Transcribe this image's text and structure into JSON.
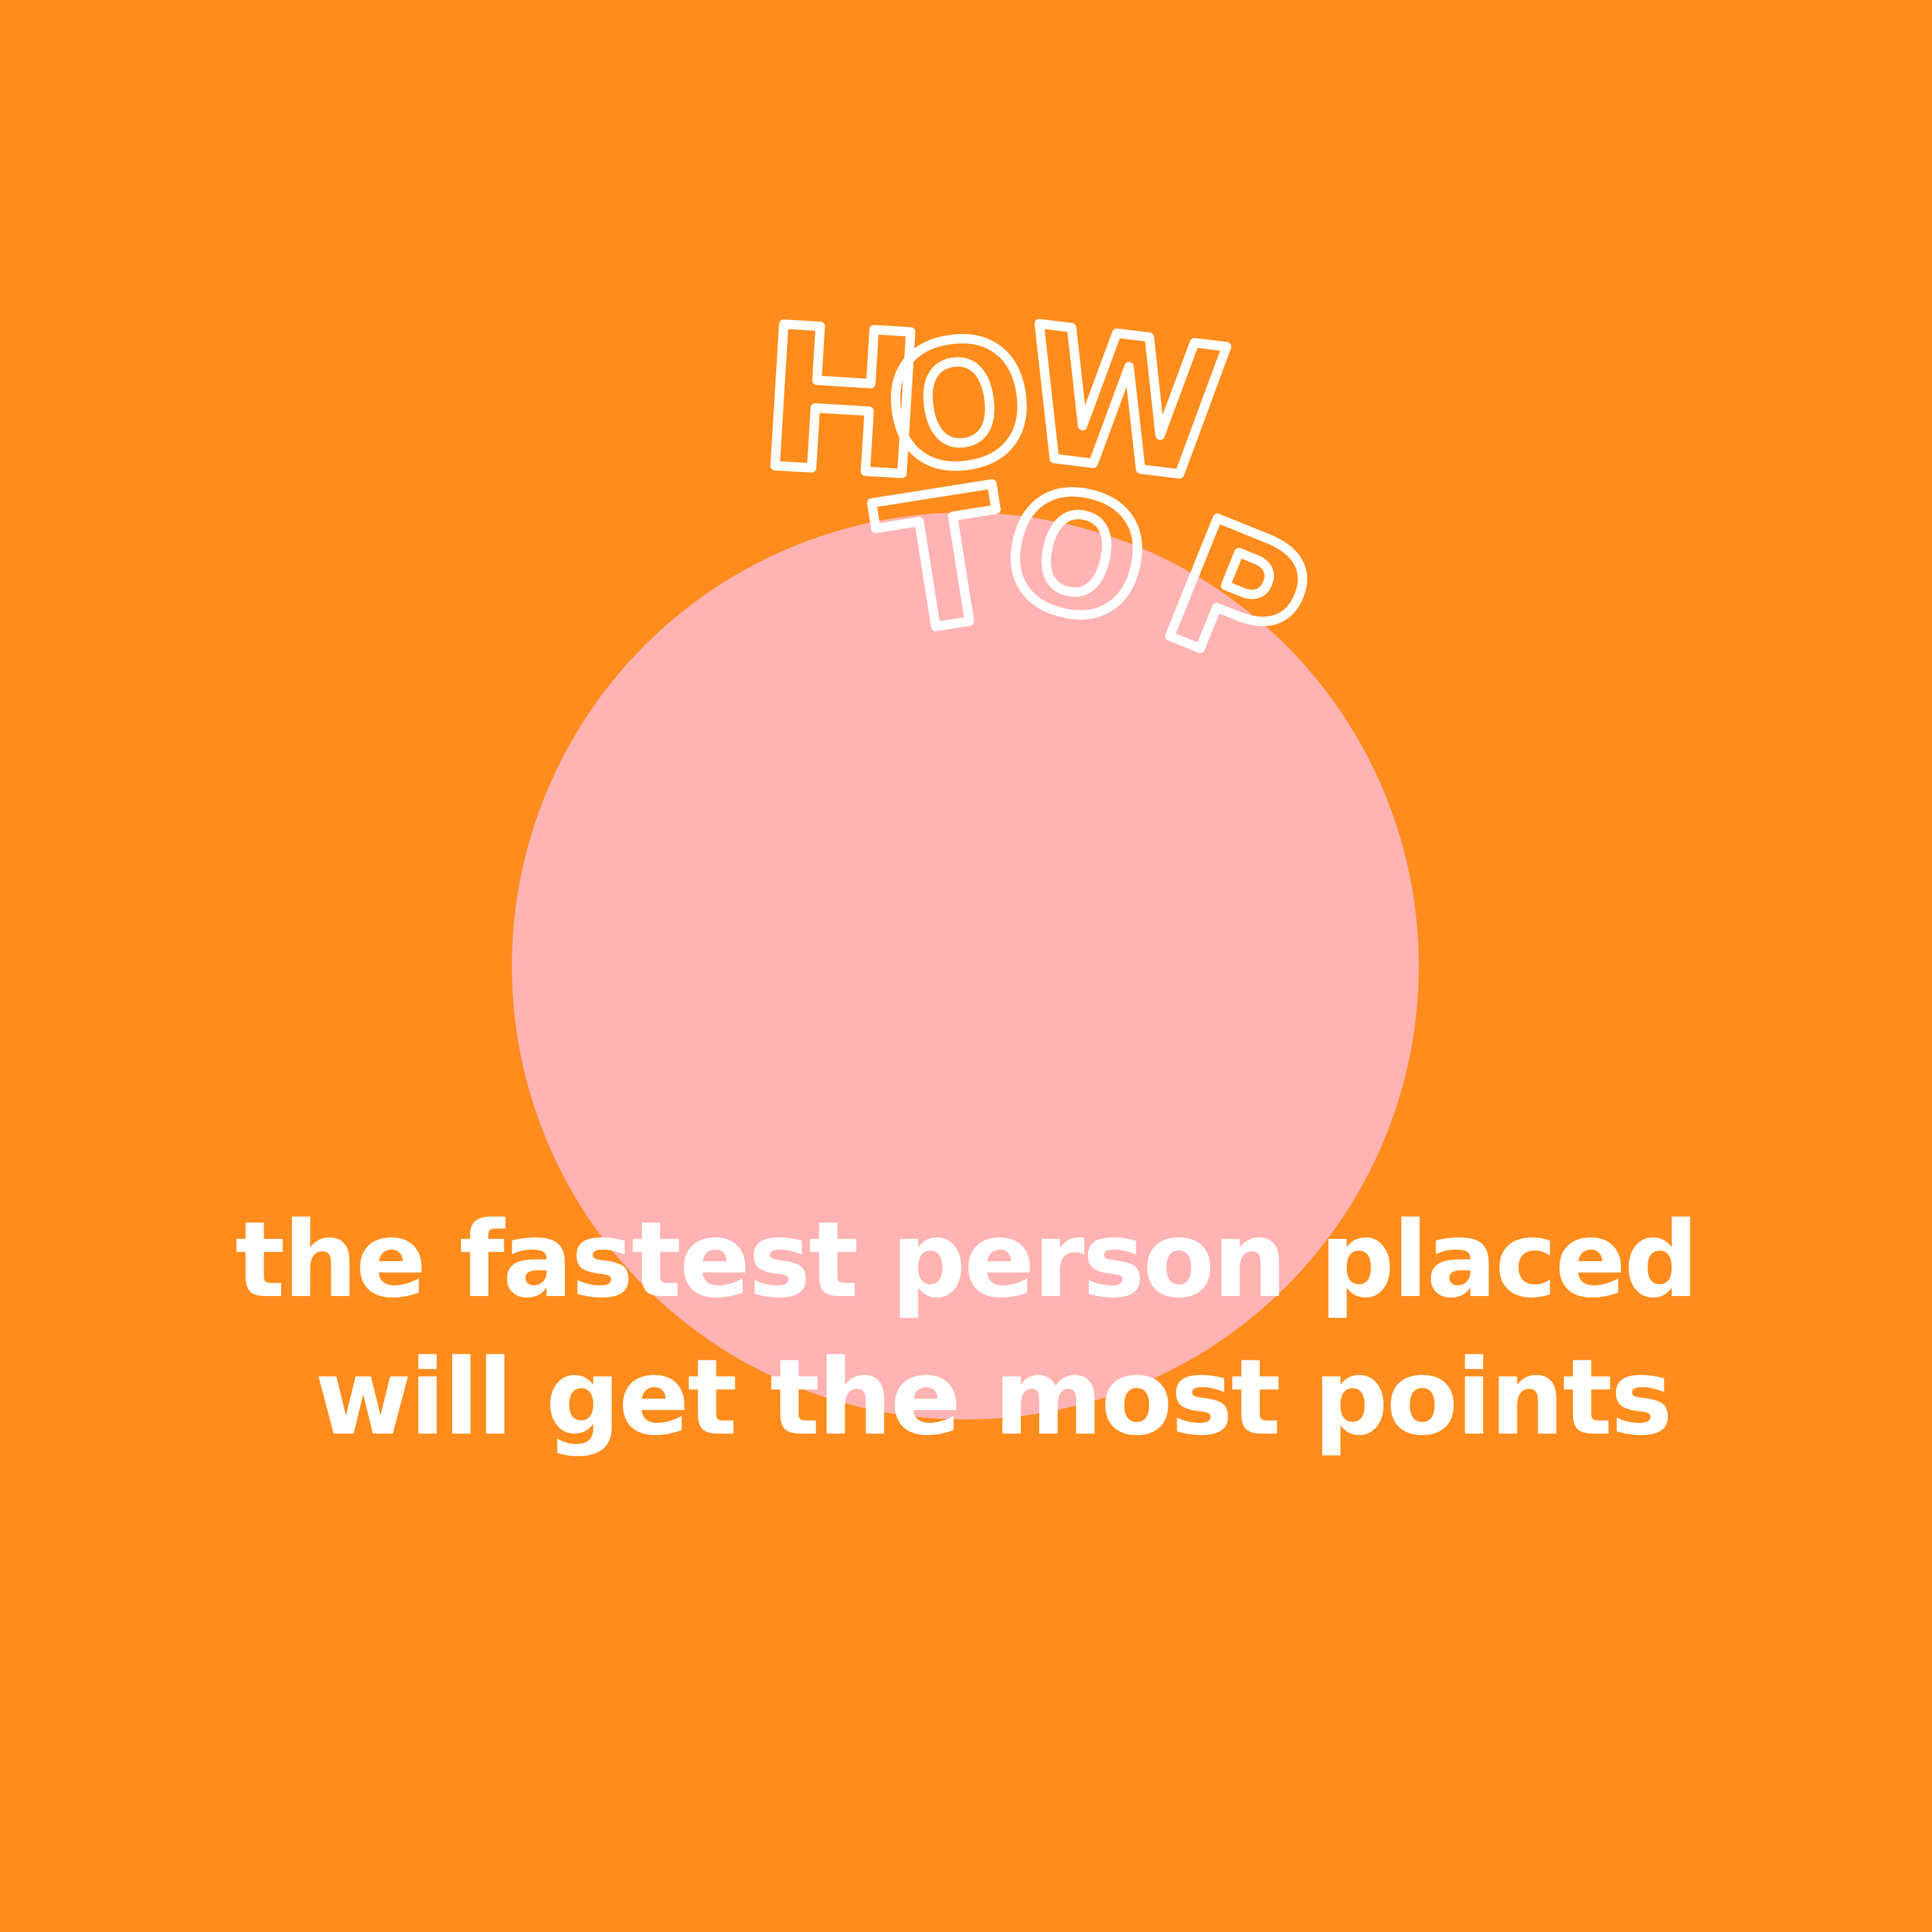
{
  "headline": {
    "word_1": [
      "H",
      "O",
      "W"
    ],
    "word_2": [
      "T",
      "O",
      "P"
    ]
  },
  "body": {
    "line_1": "the fastest person placed",
    "line_2": "will get the most points"
  },
  "colors": {
    "background": "#FF8C1C",
    "circle": "#FFB3B3",
    "text": "#FFFFFF"
  }
}
